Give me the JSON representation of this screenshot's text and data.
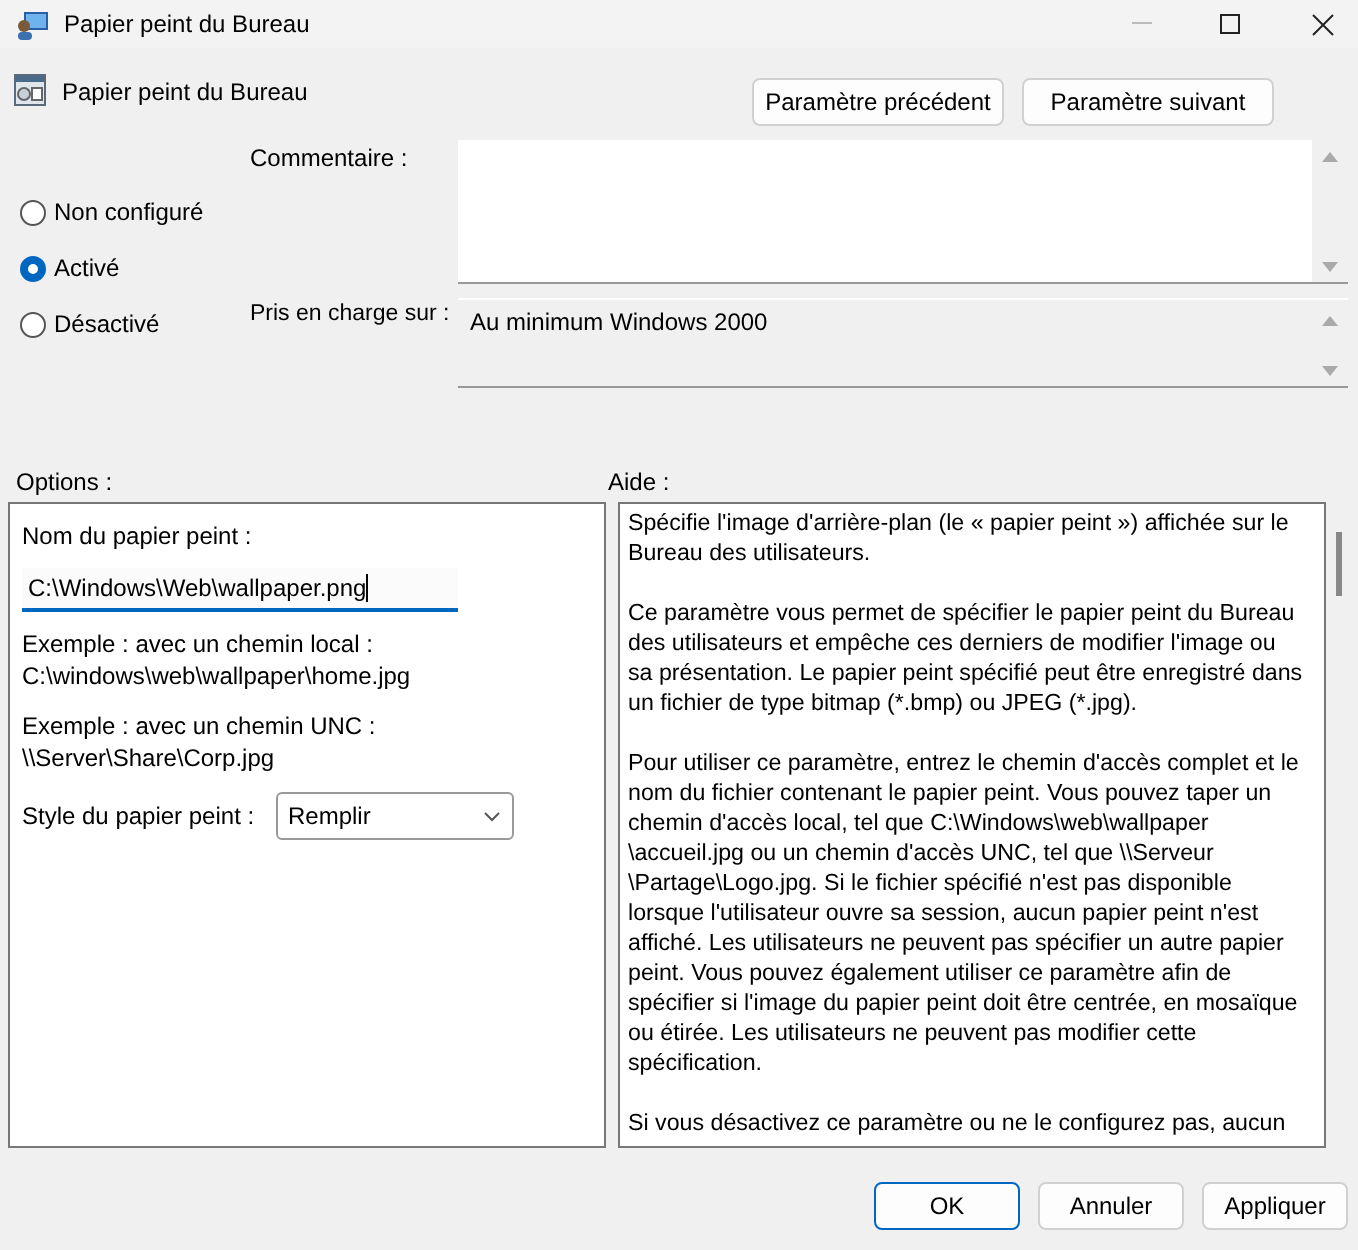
{
  "window": {
    "title": "Papier peint du Bureau"
  },
  "header": {
    "title": "Papier peint du Bureau",
    "buttons": [
      "Paramètre précédent",
      "Paramètre suivant"
    ]
  },
  "state_options": [
    {
      "label": "Non configuré",
      "selected": false
    },
    {
      "label": "Activé",
      "selected": true
    },
    {
      "label": "Désactivé",
      "selected": false
    }
  ],
  "comment": {
    "label": "Commentaire :"
  },
  "supported_on": {
    "label": "Pris en charge sur :",
    "value": "Au minimum Windows 2000"
  },
  "options": {
    "label": "Options :",
    "items": [
      {
        "kind": "label",
        "text": "Nom du papier peint :"
      },
      {
        "kind": "input",
        "value": "C:\\Windows\\Web\\wallpaper.png"
      },
      {
        "kind": "note",
        "lines": [
          "Exemple : avec un chemin local :",
          "C:\\windows\\web\\wallpaper\\home.jpg"
        ]
      },
      {
        "kind": "note",
        "lines": [
          "Exemple : avec un chemin UNC :",
          "\\\\Server\\Share\\Corp.jpg"
        ]
      },
      {
        "kind": "select",
        "label": "Style du papier peint :",
        "value": "Remplir"
      }
    ]
  },
  "help": {
    "label": "Aide :",
    "paragraphs": [
      [
        "Spécifie l'image d'arrière-plan (le « papier peint ») affichée sur le",
        "Bureau des utilisateurs."
      ],
      [
        "Ce paramètre vous permet de spécifier le papier peint du Bureau",
        "des utilisateurs et empêche ces derniers de modifier l'image ou",
        "sa présentation. Le papier peint spécifié peut être enregistré dans",
        "un fichier de type bitmap (*.bmp) ou JPEG (*.jpg)."
      ],
      [
        "Pour utiliser ce paramètre, entrez le chemin d'accès complet et le",
        "nom du fichier contenant le papier peint. Vous pouvez taper un",
        "chemin d'accès local, tel que C:\\Windows\\web\\wallpaper",
        "\\accueil.jpg ou un chemin d'accès UNC, tel que \\\\Serveur",
        "\\Partage\\Logo.jpg. Si le fichier spécifié n'est pas disponible",
        "lorsque l'utilisateur ouvre sa session, aucun papier peint n'est",
        "affiché. Les utilisateurs ne peuvent pas spécifier un autre papier",
        "peint. Vous pouvez également utiliser ce paramètre afin de",
        "spécifier si l'image du papier peint doit être centrée, en mosaïque",
        "ou étirée. Les utilisateurs ne peuvent pas modifier cette",
        "spécification."
      ],
      [
        "Si vous désactivez ce paramètre ou ne le configurez pas, aucun"
      ]
    ]
  },
  "buttons": [
    {
      "label": "OK",
      "default": true
    },
    {
      "label": "Annuler",
      "default": false
    },
    {
      "label": "Appliquer",
      "default": false
    }
  ]
}
